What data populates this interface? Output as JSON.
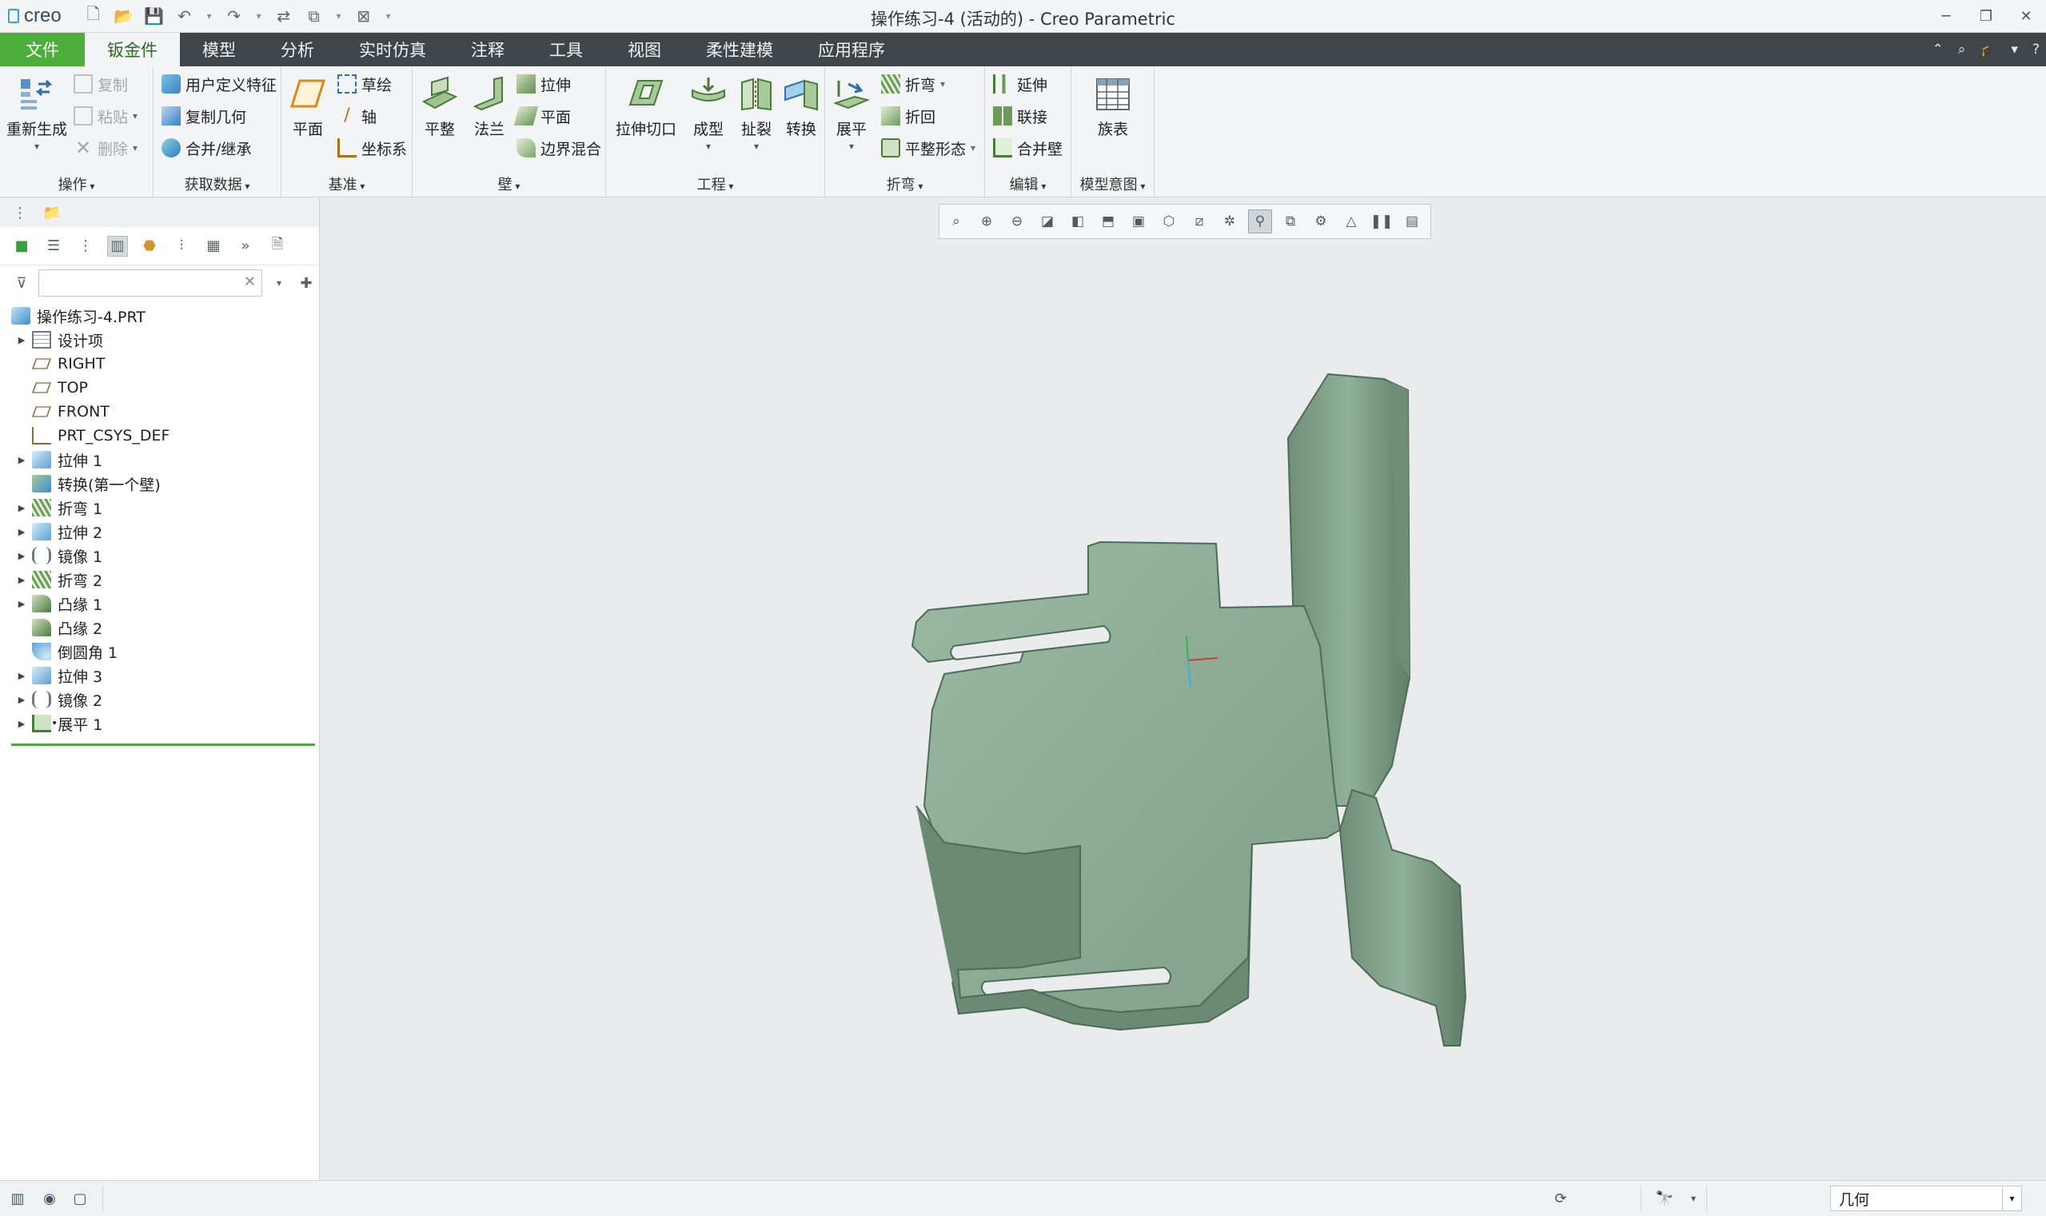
{
  "app": {
    "logo": "creo",
    "title": "操作练习-4 (活动的) - Creo Parametric"
  },
  "menu": {
    "file": "文件",
    "tabs": [
      "钣金件",
      "模型",
      "分析",
      "实时仿真",
      "注释",
      "工具",
      "视图",
      "柔性建模",
      "应用程序"
    ]
  },
  "ribbon": {
    "groups": {
      "operations": "操作",
      "get_data": "获取数据",
      "datum": "基准",
      "wall": "壁",
      "engineering": "工程",
      "bend": "折弯",
      "edit": "编辑",
      "model_intent": "模型意图"
    },
    "buttons": {
      "regenerate": "重新生成",
      "copy": "复制",
      "paste": "粘贴",
      "delete": "删除",
      "udf": "用户定义特征",
      "copy_geom": "复制几何",
      "merge_inherit": "合并/继承",
      "plane": "平面",
      "sketch": "草绘",
      "axis": "轴",
      "csys": "坐标系",
      "flat": "平整",
      "flange": "法兰",
      "extrude": "拉伸",
      "plane_wall": "平面",
      "boundary_blend": "边界混合",
      "extrude_cut": "拉伸切口",
      "form": "成型",
      "rip": "扯裂",
      "convert": "转换",
      "unbend": "展平",
      "bend": "折弯",
      "bend_back": "折回",
      "flat_state": "平整形态",
      "extend": "延伸",
      "join": "联接",
      "merge_walls": "合并壁",
      "family_table": "族表"
    }
  },
  "tree": {
    "search_placeholder": "",
    "items": [
      {
        "label": "操作练习-4.PRT",
        "icon": "part-icon",
        "expandable": false,
        "root": true
      },
      {
        "label": "设计项",
        "icon": "design-items-icon",
        "expandable": true
      },
      {
        "label": "RIGHT",
        "icon": "datum-plane-icon",
        "expandable": false
      },
      {
        "label": "TOP",
        "icon": "datum-plane-icon",
        "expandable": false
      },
      {
        "label": "FRONT",
        "icon": "datum-plane-icon",
        "expandable": false
      },
      {
        "label": "PRT_CSYS_DEF",
        "icon": "csys-icon",
        "expandable": false
      },
      {
        "label": "拉伸 1",
        "icon": "extrude-icon",
        "expandable": true
      },
      {
        "label": "转换(第一个壁)",
        "icon": "convert-icon",
        "expandable": false
      },
      {
        "label": "折弯 1",
        "icon": "bend-icon",
        "expandable": true
      },
      {
        "label": "拉伸 2",
        "icon": "extrude-icon",
        "expandable": true
      },
      {
        "label": "镜像 1",
        "icon": "mirror-icon",
        "expandable": true
      },
      {
        "label": "折弯 2",
        "icon": "bend-icon",
        "expandable": true
      },
      {
        "label": "凸缘 1",
        "icon": "flange-icon",
        "expandable": true
      },
      {
        "label": "凸缘 2",
        "icon": "flange-icon",
        "expandable": false
      },
      {
        "label": "倒圆角 1",
        "icon": "round-icon",
        "expandable": false
      },
      {
        "label": "拉伸 3",
        "icon": "extrude-icon",
        "expandable": true
      },
      {
        "label": "镜像 2",
        "icon": "mirror-icon",
        "expandable": true
      },
      {
        "label": "展平 1",
        "icon": "unbend-icon",
        "expandable": true,
        "starred": true
      }
    ]
  },
  "status": {
    "filter_value": "几何"
  },
  "colors": {
    "accent_green": "#4cae3b",
    "menubar": "#3f4548",
    "model_face": "#8fae98"
  }
}
